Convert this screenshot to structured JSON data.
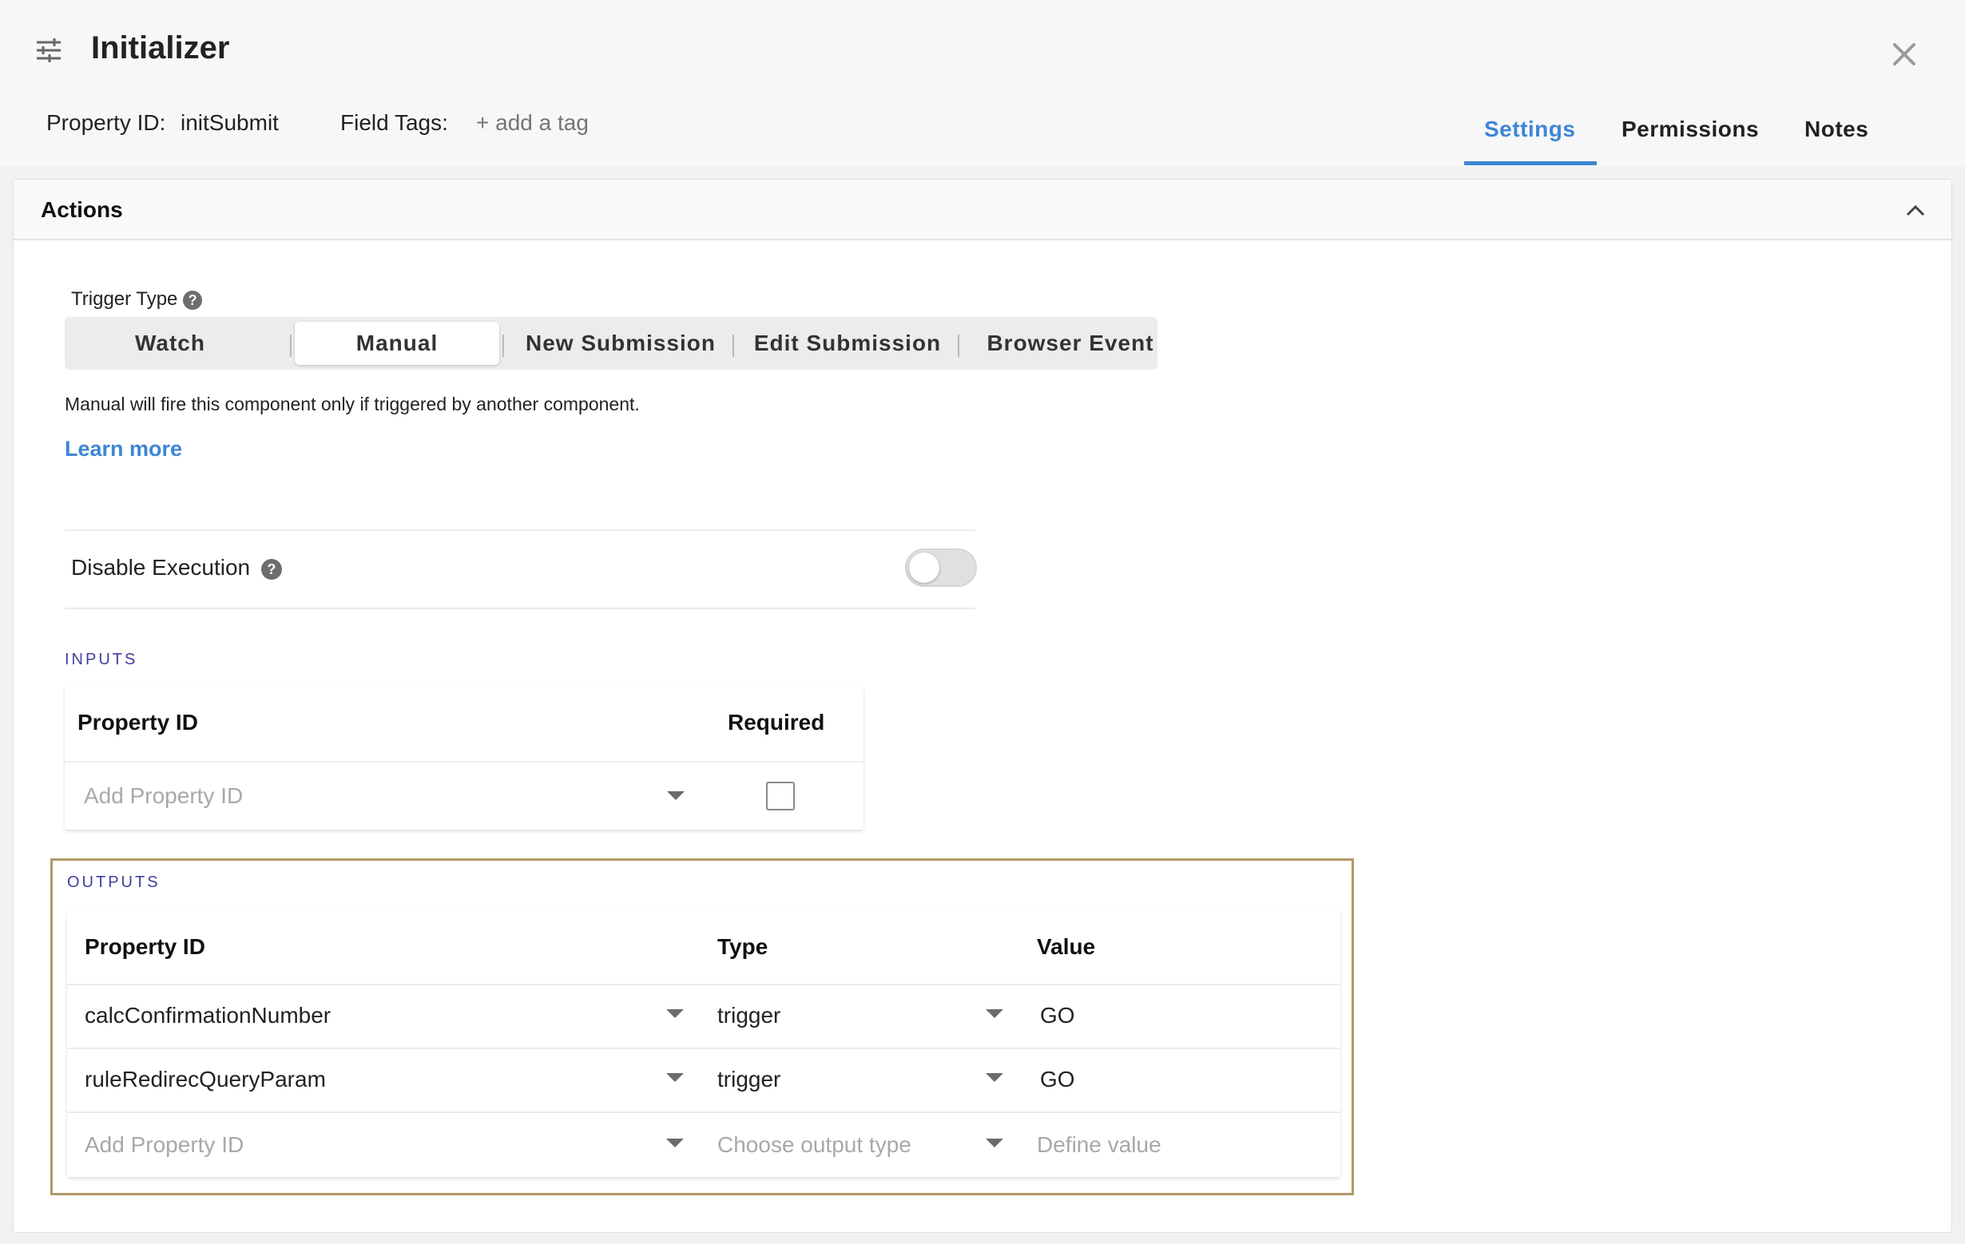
{
  "header": {
    "title": "Initializer",
    "property_id_label": "Property ID:",
    "property_id_value": "initSubmit",
    "field_tags_label": "Field Tags:",
    "add_tag": "+ add a tag",
    "tabs": [
      {
        "label": "Settings",
        "active": true
      },
      {
        "label": "Permissions",
        "active": false
      },
      {
        "label": "Notes",
        "active": false
      }
    ]
  },
  "panel": {
    "title": "Actions",
    "trigger_type_label": "Trigger Type",
    "trigger_options": [
      "Watch",
      "Manual",
      "New Submission",
      "Edit Submission",
      "Browser Event"
    ],
    "selected_trigger": "Manual",
    "trigger_description": "Manual will fire this component only if triggered by another component.",
    "learn_more": "Learn more",
    "disable_execution_label": "Disable Execution",
    "disable_execution_on": false
  },
  "inputs": {
    "label": "INPUTS",
    "headers": [
      "Property ID",
      "Required"
    ],
    "placeholder": "Add Property ID",
    "required_checked": false
  },
  "outputs": {
    "label": "OUTPUTS",
    "headers": [
      "Property ID",
      "Type",
      "Value"
    ],
    "rows": [
      {
        "property_id": "calcConfirmationNumber",
        "type": "trigger",
        "value": "GO"
      },
      {
        "property_id": "ruleRedirecQueryParam",
        "type": "trigger",
        "value": "GO"
      }
    ],
    "placeholders": {
      "property_id": "Add Property ID",
      "type": "Choose output type",
      "value": "Define value"
    }
  },
  "colors": {
    "accent": "#3d86d4",
    "section_label": "#3f3f9f",
    "highlight_border": "#b09a68"
  }
}
